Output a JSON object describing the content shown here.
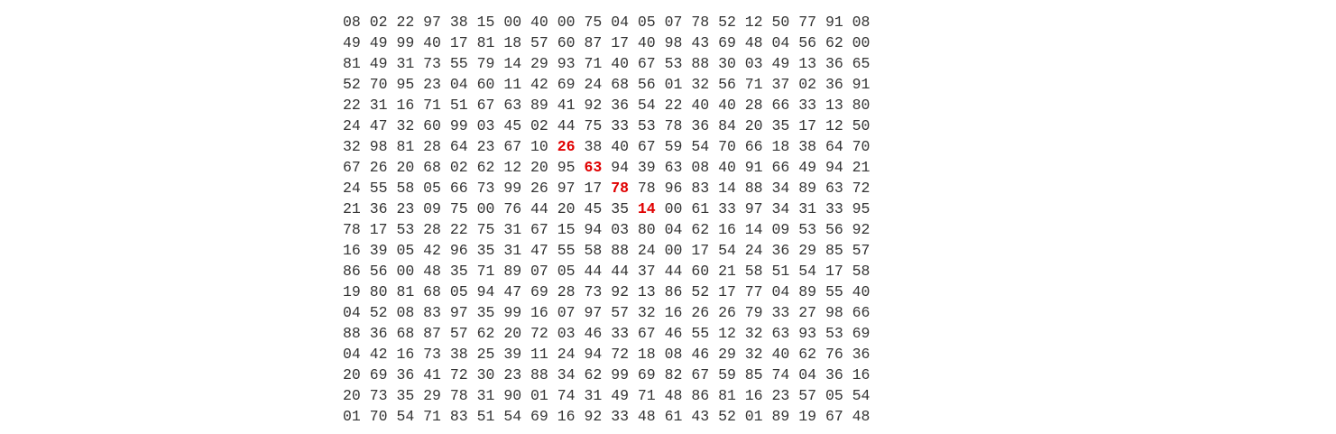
{
  "grid": {
    "rows": [
      [
        "08",
        "02",
        "22",
        "97",
        "38",
        "15",
        "00",
        "40",
        "00",
        "75",
        "04",
        "05",
        "07",
        "78",
        "52",
        "12",
        "50",
        "77",
        "91",
        "08"
      ],
      [
        "49",
        "49",
        "99",
        "40",
        "17",
        "81",
        "18",
        "57",
        "60",
        "87",
        "17",
        "40",
        "98",
        "43",
        "69",
        "48",
        "04",
        "56",
        "62",
        "00"
      ],
      [
        "81",
        "49",
        "31",
        "73",
        "55",
        "79",
        "14",
        "29",
        "93",
        "71",
        "40",
        "67",
        "53",
        "88",
        "30",
        "03",
        "49",
        "13",
        "36",
        "65"
      ],
      [
        "52",
        "70",
        "95",
        "23",
        "04",
        "60",
        "11",
        "42",
        "69",
        "24",
        "68",
        "56",
        "01",
        "32",
        "56",
        "71",
        "37",
        "02",
        "36",
        "91"
      ],
      [
        "22",
        "31",
        "16",
        "71",
        "51",
        "67",
        "63",
        "89",
        "41",
        "92",
        "36",
        "54",
        "22",
        "40",
        "40",
        "28",
        "66",
        "33",
        "13",
        "80"
      ],
      [
        "24",
        "47",
        "32",
        "60",
        "99",
        "03",
        "45",
        "02",
        "44",
        "75",
        "33",
        "53",
        "78",
        "36",
        "84",
        "20",
        "35",
        "17",
        "12",
        "50"
      ],
      [
        "32",
        "98",
        "81",
        "28",
        "64",
        "23",
        "67",
        "10",
        "26",
        "38",
        "40",
        "67",
        "59",
        "54",
        "70",
        "66",
        "18",
        "38",
        "64",
        "70"
      ],
      [
        "67",
        "26",
        "20",
        "68",
        "02",
        "62",
        "12",
        "20",
        "95",
        "63",
        "94",
        "39",
        "63",
        "08",
        "40",
        "91",
        "66",
        "49",
        "94",
        "21"
      ],
      [
        "24",
        "55",
        "58",
        "05",
        "66",
        "73",
        "99",
        "26",
        "97",
        "17",
        "78",
        "78",
        "96",
        "83",
        "14",
        "88",
        "34",
        "89",
        "63",
        "72"
      ],
      [
        "21",
        "36",
        "23",
        "09",
        "75",
        "00",
        "76",
        "44",
        "20",
        "45",
        "35",
        "14",
        "00",
        "61",
        "33",
        "97",
        "34",
        "31",
        "33",
        "95"
      ],
      [
        "78",
        "17",
        "53",
        "28",
        "22",
        "75",
        "31",
        "67",
        "15",
        "94",
        "03",
        "80",
        "04",
        "62",
        "16",
        "14",
        "09",
        "53",
        "56",
        "92"
      ],
      [
        "16",
        "39",
        "05",
        "42",
        "96",
        "35",
        "31",
        "47",
        "55",
        "58",
        "88",
        "24",
        "00",
        "17",
        "54",
        "24",
        "36",
        "29",
        "85",
        "57"
      ],
      [
        "86",
        "56",
        "00",
        "48",
        "35",
        "71",
        "89",
        "07",
        "05",
        "44",
        "44",
        "37",
        "44",
        "60",
        "21",
        "58",
        "51",
        "54",
        "17",
        "58"
      ],
      [
        "19",
        "80",
        "81",
        "68",
        "05",
        "94",
        "47",
        "69",
        "28",
        "73",
        "92",
        "13",
        "86",
        "52",
        "17",
        "77",
        "04",
        "89",
        "55",
        "40"
      ],
      [
        "04",
        "52",
        "08",
        "83",
        "97",
        "35",
        "99",
        "16",
        "07",
        "97",
        "57",
        "32",
        "16",
        "26",
        "26",
        "79",
        "33",
        "27",
        "98",
        "66"
      ],
      [
        "88",
        "36",
        "68",
        "87",
        "57",
        "62",
        "20",
        "72",
        "03",
        "46",
        "33",
        "67",
        "46",
        "55",
        "12",
        "32",
        "63",
        "93",
        "53",
        "69"
      ],
      [
        "04",
        "42",
        "16",
        "73",
        "38",
        "25",
        "39",
        "11",
        "24",
        "94",
        "72",
        "18",
        "08",
        "46",
        "29",
        "32",
        "40",
        "62",
        "76",
        "36"
      ],
      [
        "20",
        "69",
        "36",
        "41",
        "72",
        "30",
        "23",
        "88",
        "34",
        "62",
        "99",
        "69",
        "82",
        "67",
        "59",
        "85",
        "74",
        "04",
        "36",
        "16"
      ],
      [
        "20",
        "73",
        "35",
        "29",
        "78",
        "31",
        "90",
        "01",
        "74",
        "31",
        "49",
        "71",
        "48",
        "86",
        "81",
        "16",
        "23",
        "57",
        "05",
        "54"
      ],
      [
        "01",
        "70",
        "54",
        "71",
        "83",
        "51",
        "54",
        "69",
        "16",
        "92",
        "33",
        "48",
        "61",
        "43",
        "52",
        "01",
        "89",
        "19",
        "67",
        "48"
      ]
    ],
    "highlighted": [
      [
        6,
        8
      ],
      [
        7,
        9
      ],
      [
        8,
        10
      ],
      [
        9,
        11
      ]
    ],
    "colors": {
      "text": "#333333",
      "highlight": "#e00000",
      "background": "#ffffff"
    }
  }
}
